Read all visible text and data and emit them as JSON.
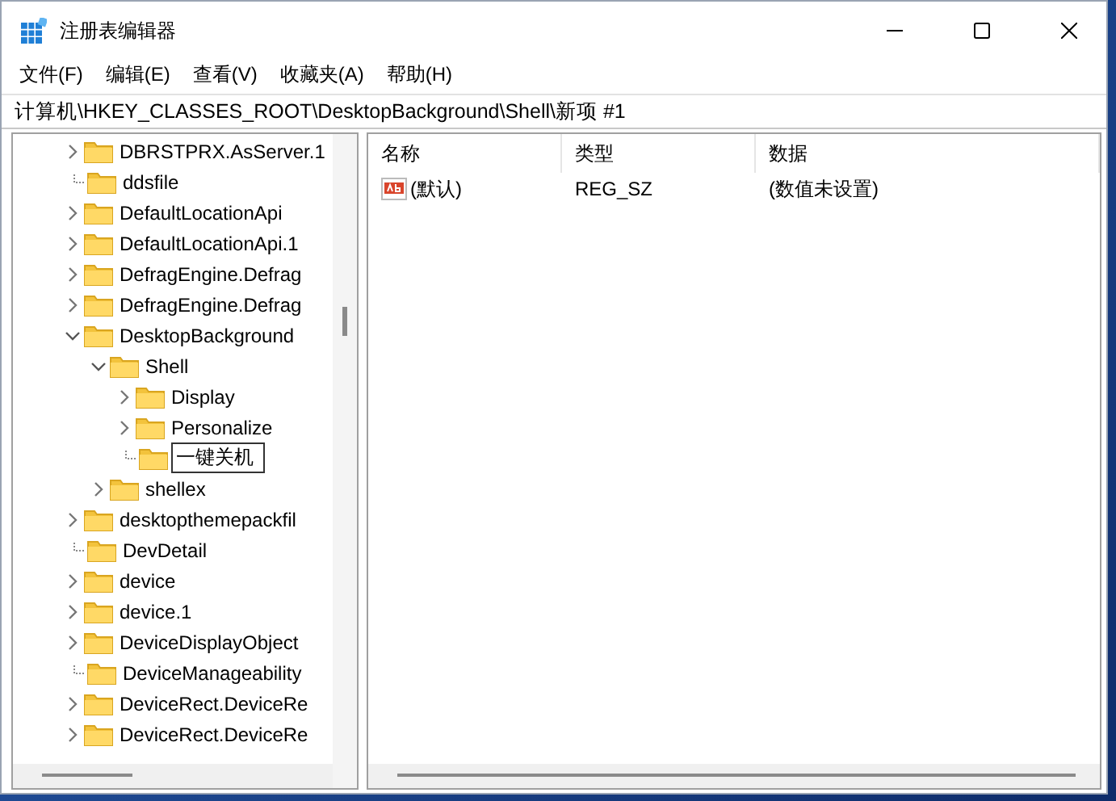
{
  "window": {
    "title": "注册表编辑器"
  },
  "menu": [
    "文件(F)",
    "编辑(E)",
    "查看(V)",
    "收藏夹(A)",
    "帮助(H)"
  ],
  "address": "计算机\\HKEY_CLASSES_ROOT\\DesktopBackground\\Shell\\新项 #1",
  "tree": [
    {
      "name": "DBRSTPRX.AsServer.1",
      "expandable": true,
      "expanded": false,
      "editing": false
    },
    {
      "name": "ddsfile",
      "expandable": false,
      "editing": false
    },
    {
      "name": "DefaultLocationApi",
      "expandable": true,
      "expanded": false,
      "editing": false
    },
    {
      "name": "DefaultLocationApi.1",
      "expandable": true,
      "expanded": false,
      "editing": false
    },
    {
      "name": "DefragEngine.Defrag",
      "expandable": true,
      "expanded": false,
      "editing": false
    },
    {
      "name": "DefragEngine.Defrag",
      "expandable": true,
      "expanded": false,
      "editing": false
    },
    {
      "name": "DesktopBackground",
      "expandable": true,
      "expanded": true,
      "editing": false,
      "children": [
        {
          "name": "Shell",
          "expandable": true,
          "expanded": true,
          "editing": false,
          "children": [
            {
              "name": "Display",
              "expandable": true,
              "expanded": false,
              "editing": false
            },
            {
              "name": "Personalize",
              "expandable": true,
              "expanded": false,
              "editing": false
            },
            {
              "name": "一键关机",
              "expandable": false,
              "editing": true
            }
          ]
        },
        {
          "name": "shellex",
          "expandable": true,
          "expanded": false,
          "editing": false
        }
      ]
    },
    {
      "name": "desktopthemepackfil",
      "expandable": true,
      "expanded": false,
      "editing": false
    },
    {
      "name": "DevDetail",
      "expandable": false,
      "editing": false
    },
    {
      "name": "device",
      "expandable": true,
      "expanded": false,
      "editing": false
    },
    {
      "name": "device.1",
      "expandable": true,
      "expanded": false,
      "editing": false
    },
    {
      "name": "DeviceDisplayObject",
      "expandable": true,
      "expanded": false,
      "editing": false
    },
    {
      "name": "DeviceManageability",
      "expandable": false,
      "editing": false
    },
    {
      "name": "DeviceRect.DeviceRe",
      "expandable": true,
      "expanded": false,
      "editing": false
    },
    {
      "name": "DeviceRect.DeviceRe",
      "expandable": true,
      "expanded": false,
      "editing": false
    }
  ],
  "list": {
    "columns": [
      "名称",
      "类型",
      "数据"
    ],
    "rows": [
      {
        "name": "(默认)",
        "type": "REG_SZ",
        "data": "(数值未设置)"
      }
    ]
  }
}
